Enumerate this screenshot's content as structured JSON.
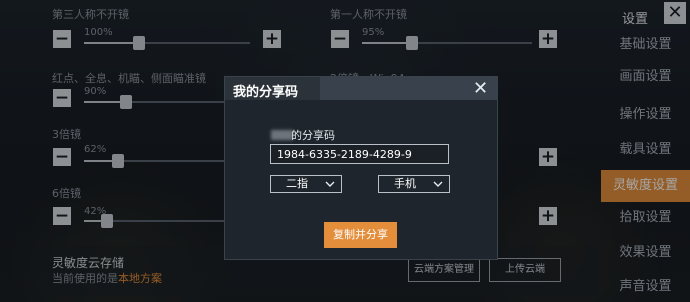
{
  "left_settings": {
    "row1": {
      "label": "第三人称不开镜",
      "percent": "100%",
      "value": 1.0
    },
    "row2": {
      "label": "红点、全息、机瞄、侧面瞄准镜",
      "percent": "90%",
      "value": 0.9
    },
    "row3": {
      "label": "3倍镜",
      "percent": "62%",
      "value": 0.62
    },
    "row4": {
      "label": "6倍镜",
      "percent": "42%",
      "value": 0.42
    }
  },
  "right_settings": {
    "row1": {
      "label": "第一人称不开镜",
      "percent": "95%",
      "value": 0.95
    },
    "row2": {
      "label": "2倍镜、Win94"
    }
  },
  "stepper": {
    "minus": "−",
    "plus": "+"
  },
  "nav": {
    "header": "设置",
    "close": "✕",
    "items": [
      "基础设置",
      "画面设置",
      "操作设置",
      "载具设置",
      "灵敏度设置",
      "拾取设置",
      "效果设置",
      "声音设置"
    ],
    "active_index": 4
  },
  "cloud": {
    "title": "灵敏度云存储",
    "subtitle_prefix": "当前使用的是",
    "subtitle_highlight": "本地方案",
    "manage_button": "云端方案管理",
    "upload_button": "上传云端"
  },
  "modal": {
    "title": "我的分享码",
    "close": "✕",
    "share_label": "的分享码",
    "code": "1984-6335-2189-4289-9",
    "finger_select": "二指",
    "device_select": "手机",
    "copy_button": "复制并分享"
  },
  "colors": {
    "accent": "#e48e3b",
    "panel": "#1f252c"
  }
}
